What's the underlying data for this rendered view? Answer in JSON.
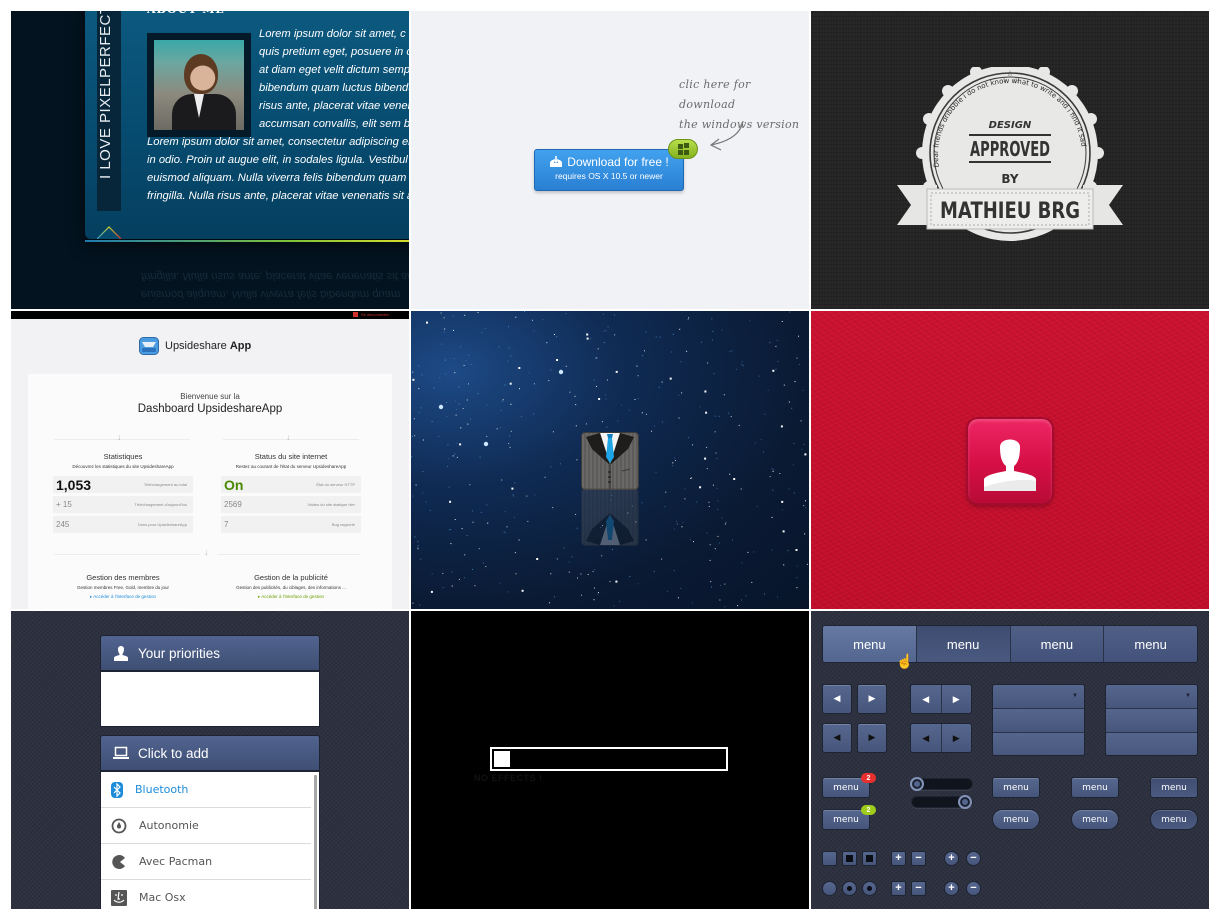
{
  "panels": {
    "about": {
      "ribbon_text": "I LOVE PIXELPERFECT",
      "heading": "ABOUT ME",
      "text_beside_photo": [
        "Lorem ipsum dolor sit amet, c",
        "quis pretium eget, posuere in c",
        "at diam eget velit dictum sempe",
        "bibendum quam luctus bibendu",
        "risus ante, placerat vitae vener",
        "accumsan convallis, elit sem b"
      ],
      "text_below_photo": [
        "Lorem ipsum dolor sit amet, consectetur adipiscing elit",
        "in odio. Proin ut augue elit, in sodales ligula. Vestibul",
        "euismod aliquam. Nulla viverra felis bibendum quam",
        "fringilla. Nulla risus ante, placerat vitae venenatis sit an"
      ],
      "reflection_lines": [
        "fringilla. Nulla risus ante, placerat vitae venenatis sit an",
        "euismod aliquam. Nulla viverra felis bibendum quam"
      ]
    },
    "download": {
      "note_line1": "clic here for download",
      "note_line2": "the windows version",
      "button_main": "Download for free !",
      "button_sub": "requires OS X 10.5 or newer",
      "badge_icon": "windows-icon"
    },
    "badge": {
      "arc_text": "Dear friends dribbble i do not know what to write and i find it sad",
      "line1": "DESIGN",
      "line2": "APPROVED",
      "line3": "BY",
      "banner": "MATHIEU BRG"
    },
    "upsideshare": {
      "logout": "Se déconnecter",
      "app_name": "Upsideshare",
      "app_name_bold": "App",
      "welcome": "Bienvenue sur la",
      "dashboard_title": "Dashboard UpsideshareApp",
      "stats": {
        "title": "Statistiques",
        "subtitle": "Découvrez les statistiques du site UpsideshareApp",
        "rows": [
          {
            "value": "1,053",
            "label": "Téléchargement au total"
          },
          {
            "value": "+ 15",
            "label": "Téléchargement d'aujourd'hui"
          },
          {
            "value": "245",
            "label": "Dons pour UpsideshareApp"
          }
        ]
      },
      "status": {
        "title": "Status du site internet",
        "subtitle": "Restez au courant de l'état du serveur UpsideshareApp",
        "rows": [
          {
            "value": "On",
            "label": "État du serveur HTTP"
          },
          {
            "value": "2569",
            "label": "Visites du site statique hier"
          },
          {
            "value": "7",
            "label": "Bug rapporté"
          }
        ]
      },
      "members": {
        "title": "Gestion des membres",
        "subtitle": "Gestion membres Free, Gold, membre du jour",
        "link": "Accéder à l'interface de gestion",
        "link_color": "#1c8bd9"
      },
      "ads": {
        "title": "Gestion de la publicité",
        "subtitle": "Gestion des publicités, du ciblages, des informations ...",
        "link": "Accéder à l'interface de gestion",
        "link_color": "#6aa000"
      }
    },
    "space": {
      "icon": "suit-tie-icon"
    },
    "contact": {
      "icon": "user-silhouette-icon",
      "accent": "#e0174f"
    },
    "priorities": {
      "priorities_title": "Your priorities",
      "add_title": "Click to add",
      "items": [
        {
          "label": "Bluetooth",
          "icon": "bluetooth-icon",
          "active": true
        },
        {
          "label": "Autonomie",
          "icon": "battery-clock-icon",
          "active": false
        },
        {
          "label": "Avec Pacman",
          "icon": "pacman-icon",
          "active": false
        },
        {
          "label": "Mac Osx",
          "icon": "finder-icon",
          "active": false
        }
      ]
    },
    "progress": {
      "value_percent": 3,
      "label": "NO EFFECTS !"
    },
    "uikit": {
      "menu_tabs": [
        "menu",
        "menu",
        "menu",
        "menu"
      ],
      "small_button_label": "menu",
      "notif_red": "2",
      "notif_green": "2",
      "slider1_value": 0,
      "slider2_value": 100
    }
  }
}
